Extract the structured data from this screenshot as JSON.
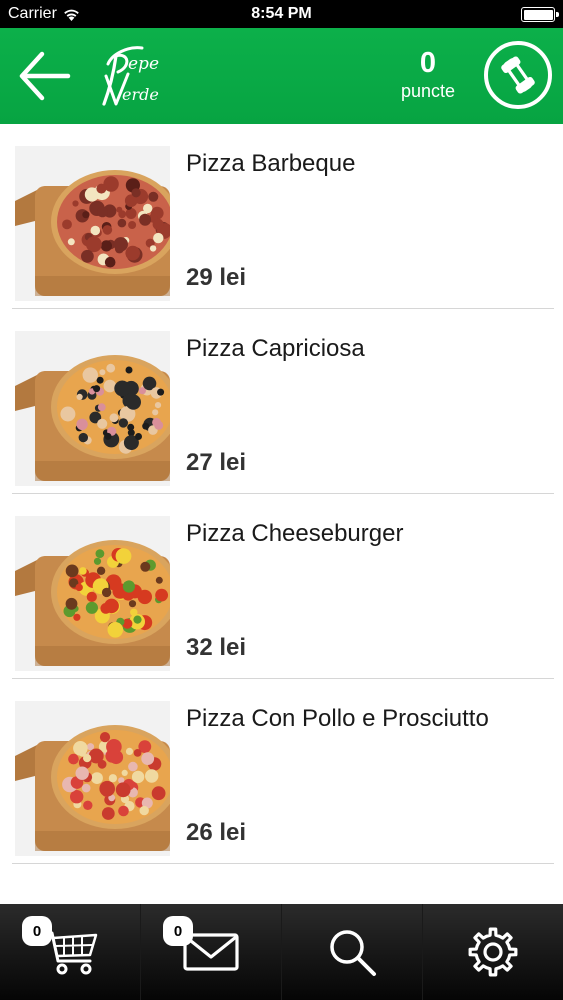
{
  "status_bar": {
    "carrier": "Carrier",
    "time": "8:54 PM",
    "battery_level": 1.0
  },
  "header": {
    "back_icon": "arrow-left-icon",
    "logo_text_top": "Pepe",
    "logo_text_bottom": "Verde",
    "points_value": "0",
    "points_label": "puncte",
    "call_icon": "phone-icon",
    "background_color": "#0aab47"
  },
  "products": [
    {
      "name": "Pizza Barbeque",
      "price": "29 lei",
      "topping": "bbq"
    },
    {
      "name": "Pizza Capriciosa",
      "price": "27 lei",
      "topping": "capriciosa"
    },
    {
      "name": "Pizza Cheeseburger",
      "price": "32 lei",
      "topping": "cheeseburger"
    },
    {
      "name": "Pizza Con Pollo e Prosciutto",
      "price": "26 lei",
      "topping": "pollo"
    }
  ],
  "tab_bar": {
    "cart": {
      "icon": "cart-icon",
      "badge": "0"
    },
    "messages": {
      "icon": "envelope-icon",
      "badge": "0"
    },
    "search": {
      "icon": "search-icon"
    },
    "settings": {
      "icon": "gear-icon"
    }
  }
}
